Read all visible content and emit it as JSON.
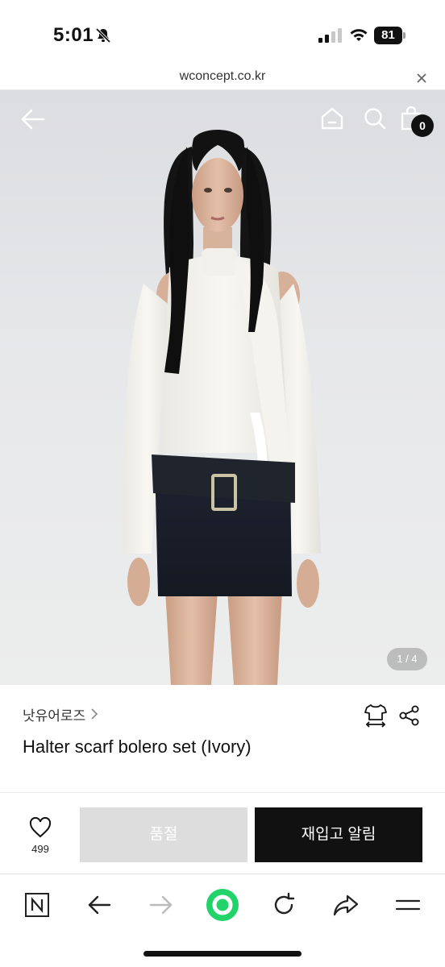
{
  "status_bar": {
    "time": "5:01",
    "battery": "81"
  },
  "url_bar": {
    "url": "wconcept.co.kr"
  },
  "hero": {
    "cart_count": "0",
    "page_indicator": "1 / 4"
  },
  "product": {
    "brand": "낫유어로즈",
    "title": "Halter scarf bolero set (Ivory)"
  },
  "actions": {
    "like_count": "499",
    "soldout_label": "품절",
    "restock_label": "재입고 알림"
  },
  "colors": {
    "accent_green": "#22d36a",
    "button_dark": "#111111",
    "button_disabled": "#dddddd"
  },
  "icons": [
    "bell-off-icon",
    "signal-icon",
    "wifi-icon",
    "close-icon",
    "back-arrow-icon",
    "home-icon",
    "search-icon",
    "shopping-bag-icon",
    "chevron-right-icon",
    "size-guide-icon",
    "share-icon",
    "heart-icon",
    "naver-icon",
    "forward-arrow-icon",
    "reload-icon",
    "share-forward-icon",
    "menu-icon"
  ]
}
